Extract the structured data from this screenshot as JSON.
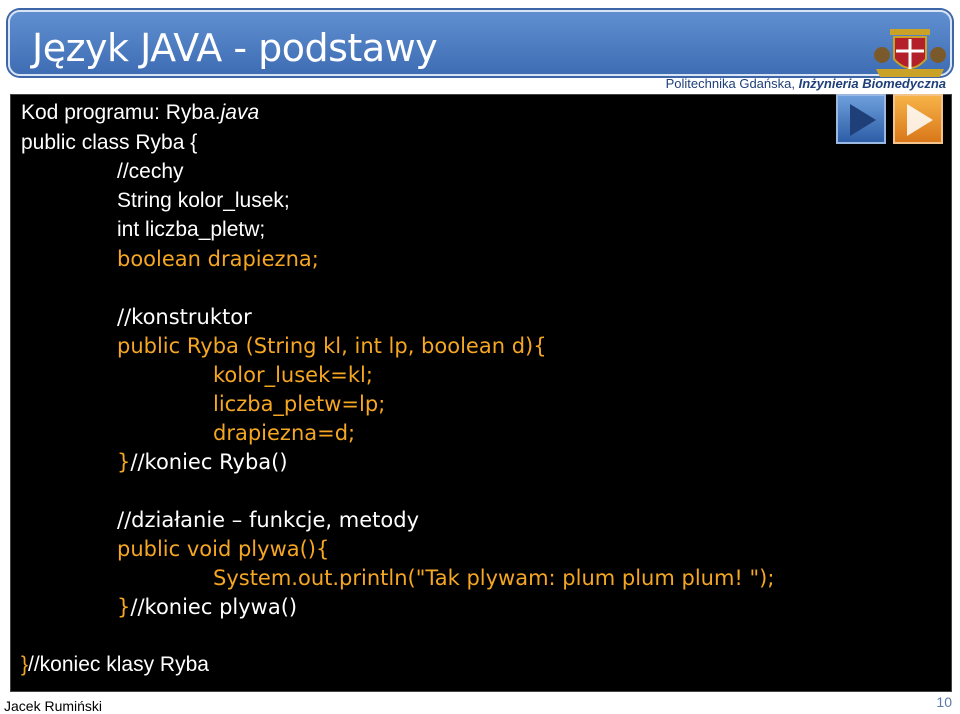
{
  "slide": {
    "title": "Język JAVA - podstawy",
    "institution_name": "Politechnika Gdańska,",
    "institution_dept": "Inżynieria Biomedyczna",
    "author": "Jacek Rumiński",
    "page_number": "10"
  },
  "code": {
    "header_bold": "Kod programu: Ryba.",
    "header_italic": "java",
    "lines": [
      "public class Ryba {",
      "//cechy",
      "String kolor_lusek;",
      "int liczba_pletw;",
      "boolean drapiezna;",
      "//konstruktor",
      "public Ryba (String kl, int lp, boolean d){",
      "kolor_lusek=kl;",
      "liczba_pletw=lp;",
      "drapiezna=d;",
      "}",
      "//koniec Ryba()",
      "//działanie – funkcje, metody",
      "public void plywa(){",
      "System.out.println(\"Tak plywam: plum plum plum! \");",
      "}",
      "//koniec plywa()",
      "}",
      "//koniec klasy Ryba"
    ]
  },
  "nav": {
    "back_icon": "play-left-icon",
    "forward_icon": "play-right-icon",
    "back_color": "#3f6db4",
    "forward_color": "#e8891f"
  },
  "colors": {
    "title_bar": "#4a7cc3",
    "code_bg": "#000000",
    "code_white": "#ffffff",
    "code_orange": "#f5a623"
  }
}
